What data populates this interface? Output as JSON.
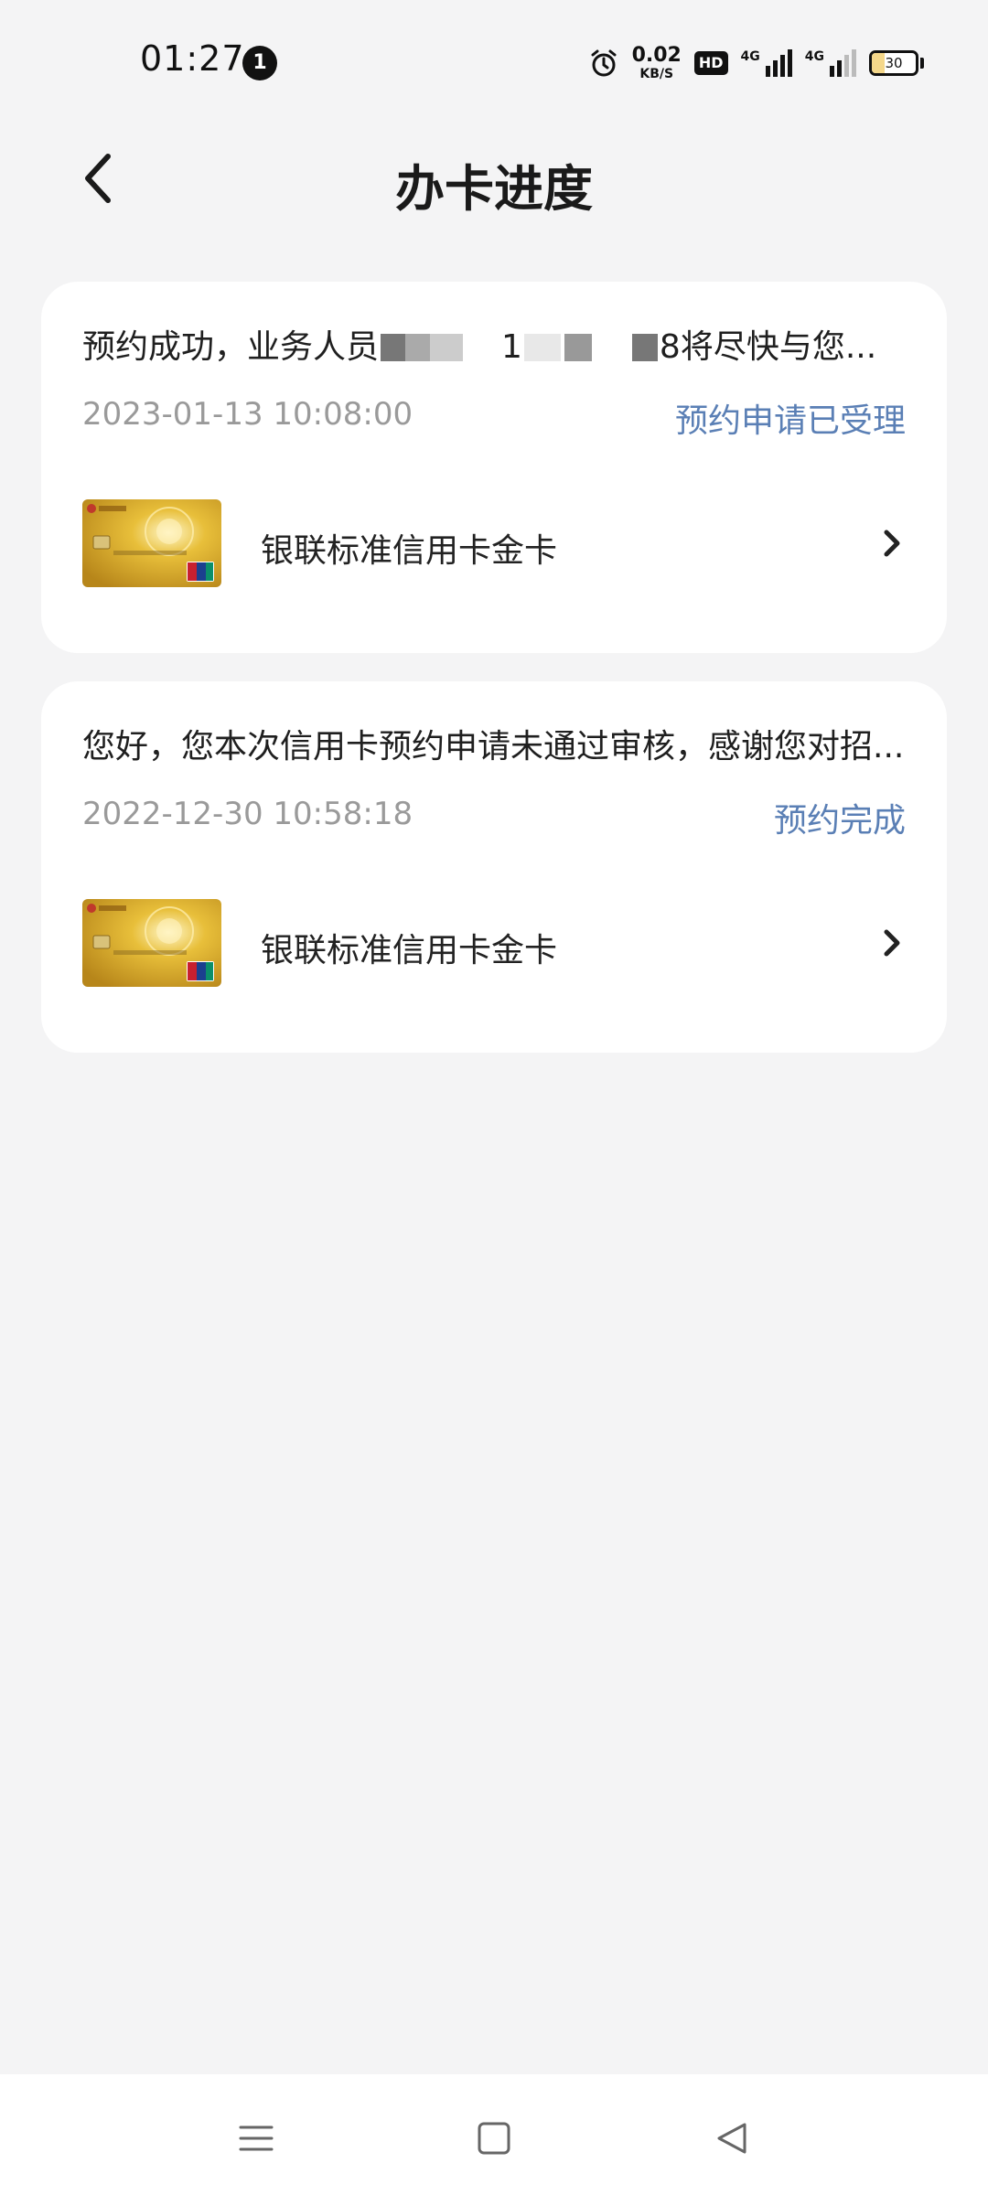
{
  "status_bar": {
    "time": "01:27",
    "notification_count": "1",
    "net_speed_value": "0.02",
    "net_speed_unit": "KB/S",
    "hd_label": "HD",
    "signal1_label": "4G",
    "signal2_label": "4G",
    "battery_level": "30",
    "battery_fraction": 0.3
  },
  "header": {
    "title": "办卡进度"
  },
  "applications": [
    {
      "message_prefix": "预约成功，业务人员",
      "message_mid": "1",
      "message_suffix": "8将尽快与您...",
      "date": "2023-01-13 10:08:00",
      "status": "预约申请已受理",
      "card_name": "银联标准信用卡金卡"
    },
    {
      "message": "您好，您本次信用卡预约申请未通过审核，感谢您对招...",
      "date": "2022-12-30 10:58:18",
      "status": "预约完成",
      "card_name": "银联标准信用卡金卡"
    }
  ],
  "colors": {
    "background": "#f4f4f5",
    "status_link": "#5a7fb5",
    "date_gray": "#9a9a9a"
  }
}
